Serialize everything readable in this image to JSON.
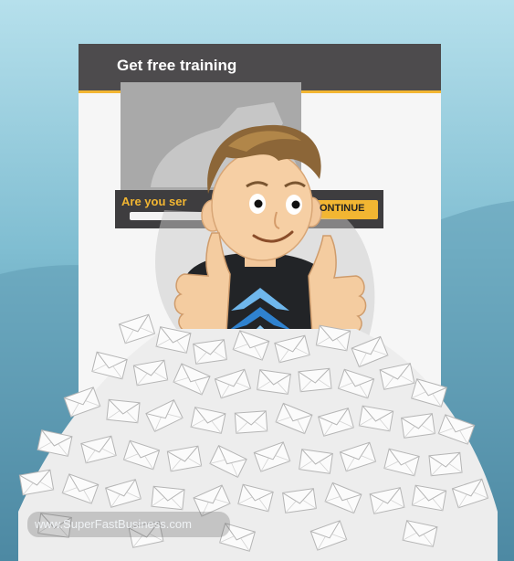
{
  "panel": {
    "title": "Get free training"
  },
  "optin": {
    "question": "Are you ser",
    "button_label": "ONTINUE"
  },
  "watermark": "www.SuperFastBusiness.com",
  "colors": {
    "sky_top": "#a3d6e4",
    "sky_bottom": "#417e98",
    "panel_header": "#4d4b4d",
    "accent_yellow": "#f2b632",
    "shirt": "#222427",
    "logo_blue": "#2f82cf"
  },
  "icons": [
    "bird-logo-icon",
    "envelope-icon"
  ]
}
